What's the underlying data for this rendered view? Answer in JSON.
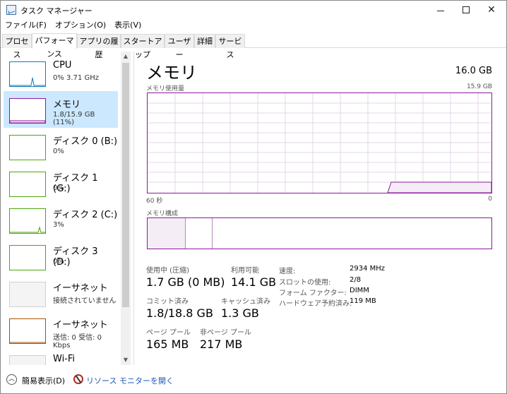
{
  "window": {
    "title": "タスク マネージャー"
  },
  "menu": [
    "ファイル(F)",
    "オプション(O)",
    "表示(V)"
  ],
  "tabs": [
    "プロセス",
    "パフォーマンス",
    "アプリの履歴",
    "スタートアップ",
    "ユーザー",
    "詳細",
    "サービス"
  ],
  "active_tab": "パフォーマンス",
  "sidebar": {
    "items": [
      {
        "title": "CPU",
        "sub": "0% 3.71 GHz",
        "color": "#117dbb"
      },
      {
        "title": "メモリ",
        "sub": "1.8/15.9 GB (11%)",
        "color": "#8b1a9b"
      },
      {
        "title": "ディスク 0 (B:)",
        "sub": "0%",
        "color": "#4da60c"
      },
      {
        "title": "ディスク 1 (G:)",
        "sub": "0%",
        "color": "#4da60c"
      },
      {
        "title": "ディスク 2 (C:)",
        "sub": "3%",
        "color": "#4da60c"
      },
      {
        "title": "ディスク 3 (D:)",
        "sub": "0%",
        "color": "#4da60c"
      },
      {
        "title": "イーサネット",
        "sub": "接続されていません",
        "color": "#d0d0d0"
      },
      {
        "title": "イーサネット",
        "sub": "送信: 0 受信: 0 Kbps",
        "color": "#a74f01"
      },
      {
        "title": "Wi-Fi",
        "sub": "",
        "color": "#d0d0d0"
      }
    ]
  },
  "main": {
    "title": "メモリ",
    "total": "16.0 GB",
    "usage_graph_label": "メモリ使用量",
    "usage_graph_max": "15.9 GB",
    "axis_left": "60 秒",
    "axis_right": "0",
    "composition_label": "メモリ構成",
    "stats": {
      "in_use_label": "使用中 (圧縮)",
      "in_use_value": "1.7 GB (0 MB)",
      "available_label": "利用可能",
      "available_value": "14.1 GB",
      "committed_label": "コミット済み",
      "committed_value": "1.8/18.8 GB",
      "cached_label": "キャッシュ済み",
      "cached_value": "1.3 GB",
      "paged_label": "ページ プール",
      "paged_value": "165 MB",
      "nonpaged_label": "非ページ プール",
      "nonpaged_value": "217 MB"
    },
    "details": [
      {
        "label": "速度:",
        "value": "2934 MHz"
      },
      {
        "label": "スロットの使用:",
        "value": "2/8"
      },
      {
        "label": "フォーム ファクター:",
        "value": "DIMM"
      },
      {
        "label": "ハードウェア予約済み:",
        "value": "119 MB"
      }
    ]
  },
  "footer": {
    "fewer_details": "簡易表示(D)",
    "resource_monitor": "リソース モニターを開く"
  },
  "colors": {
    "memory_accent": "#8b1a9b",
    "selection": "#cce8ff",
    "link": "#1a56b8"
  }
}
